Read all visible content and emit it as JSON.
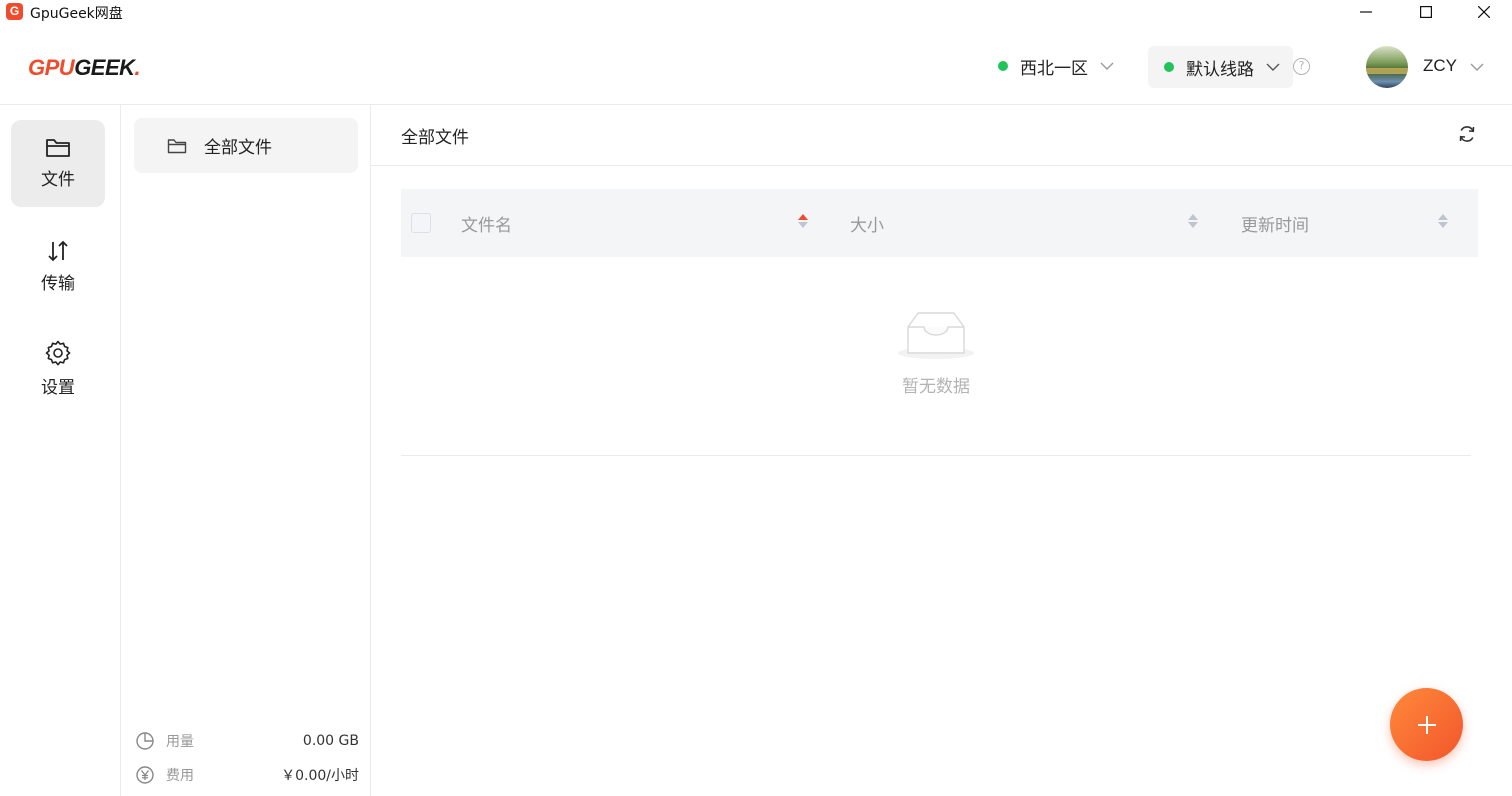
{
  "window": {
    "title": "GpuGeek网盘",
    "app_icon_letter": "G"
  },
  "header": {
    "logo": {
      "part1": "GPU",
      "part2": "GEEK",
      "part3": "."
    },
    "region": {
      "label": "西北一区",
      "status_color": "#1fc45b"
    },
    "route": {
      "label": "默认线路",
      "status_color": "#1fc45b",
      "help_glyph": "?"
    },
    "user": {
      "name": "ZCY"
    }
  },
  "nav": {
    "items": [
      {
        "label": "文件",
        "icon": "folder-icon",
        "active": true
      },
      {
        "label": "传输",
        "icon": "transfer-icon",
        "active": false
      },
      {
        "label": "设置",
        "icon": "gear-icon",
        "active": false
      }
    ]
  },
  "folders": {
    "items": [
      {
        "label": "全部文件",
        "icon": "folder-icon"
      }
    ],
    "usage": {
      "label": "用量",
      "value": "0.00 GB",
      "icon": "pie-chart-icon"
    },
    "cost": {
      "label": "费用",
      "value": "￥0.00/小时",
      "icon": "yen-icon"
    }
  },
  "main": {
    "title": "全部文件",
    "table": {
      "columns": [
        "文件名",
        "大小",
        "更新时间"
      ],
      "sorted_column": "文件名",
      "sort_direction": "ascending",
      "rows": []
    },
    "empty_text": "暂无数据"
  },
  "colors": {
    "accent": "#ef4b2c",
    "online": "#1fc45b",
    "fab_start": "#ff8a3c",
    "fab_end": "#f2552b"
  }
}
